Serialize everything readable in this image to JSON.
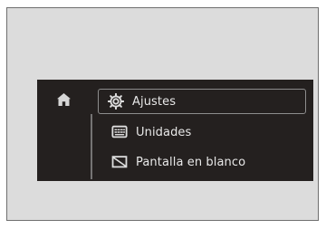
{
  "menu": {
    "home_icon": "home-icon",
    "items": [
      {
        "label": "Ajustes",
        "icon": "settings-gear-icon",
        "selected": true
      },
      {
        "label": "Unidades",
        "icon": "units-keyboard-icon",
        "selected": false
      },
      {
        "label": "Pantalla en blanco",
        "icon": "blank-screen-icon",
        "selected": false
      }
    ]
  },
  "colors": {
    "panel_background": "#24201f",
    "outer_background": "#dcdcdc",
    "text": "#e8e8e8",
    "selection_border": "#8d8d8d"
  }
}
